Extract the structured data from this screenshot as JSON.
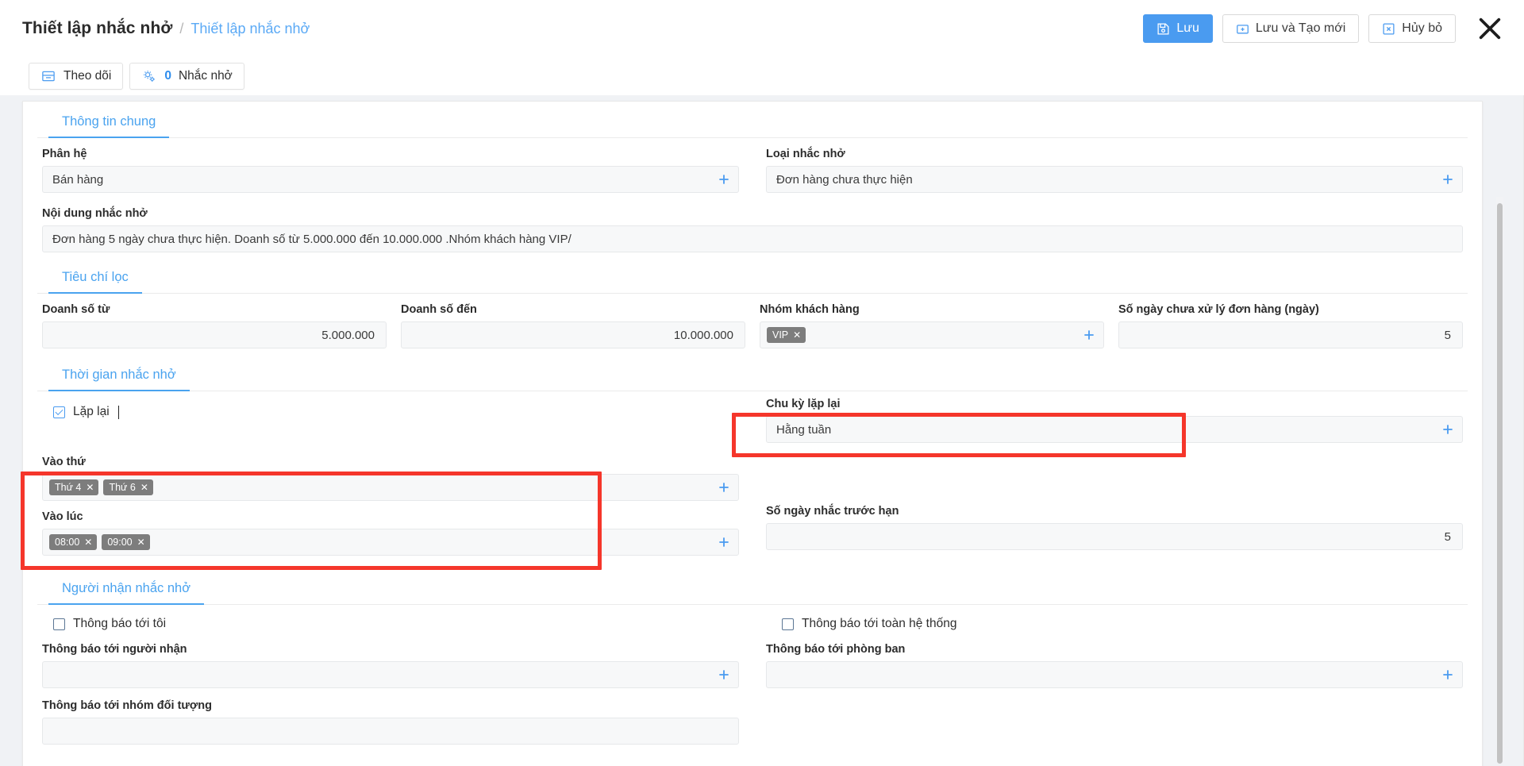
{
  "header": {
    "title": "Thiết lập nhắc nhở",
    "separator": "/",
    "breadcrumb_link": "Thiết lập nhắc nhở",
    "buttons": {
      "save": "Lưu",
      "save_new": "Lưu và Tạo mới",
      "cancel": "Hủy bỏ"
    },
    "icons": {
      "save": "floppy-disk-icon",
      "save_new": "folder-plus-icon",
      "cancel": "x-box-icon",
      "close": "close-icon"
    }
  },
  "toolbar": {
    "follow": {
      "label": "Theo dõi",
      "icon": "inbox-icon"
    },
    "reminder": {
      "count": "0",
      "label": "Nhắc nhở",
      "icon": "gears-icon"
    }
  },
  "sections": {
    "general": {
      "tab": "Thông tin chung",
      "fields": {
        "subsystem": {
          "label": "Phân hệ",
          "value": "Bán hàng"
        },
        "reminder_type": {
          "label": "Loại nhắc nhở",
          "value": "Đơn hàng chưa thực hiện"
        },
        "content": {
          "label": "Nội dung nhắc nhở",
          "value": "Đơn hàng 5 ngày chưa thực hiện. Doanh số từ 5.000.000 đến 10.000.000 .Nhóm khách hàng VIP/"
        }
      }
    },
    "filter": {
      "tab": "Tiêu chí lọc",
      "fields": {
        "revenue_from": {
          "label": "Doanh số từ",
          "value": "5.000.000"
        },
        "revenue_to": {
          "label": "Doanh số đến",
          "value": "10.000.000"
        },
        "customer_group": {
          "label": "Nhóm khách hàng",
          "tags": [
            "VIP"
          ]
        },
        "unprocessed_days": {
          "label": "Số ngày chưa xử lý đơn hàng (ngày)",
          "value": "5"
        }
      }
    },
    "schedule": {
      "tab": "Thời gian nhắc nhở",
      "repeat_checkbox": {
        "label": "Lặp lại",
        "checked": true
      },
      "fields": {
        "cycle": {
          "label": "Chu kỳ lặp lại",
          "value": "Hằng tuần"
        },
        "on_days": {
          "label": "Vào thứ",
          "tags": [
            "Thứ 4",
            "Thứ 6"
          ]
        },
        "at_times": {
          "label": "Vào lúc",
          "tags": [
            "08:00",
            "09:00"
          ]
        },
        "days_before": {
          "label": "Số ngày nhắc trước hạn",
          "value": "5"
        }
      }
    },
    "recipients": {
      "tab": "Người nhận nhắc nhở",
      "notify_me": {
        "label": "Thông báo tới tôi",
        "checked": false
      },
      "notify_all": {
        "label": "Thông báo tới toàn hệ thống",
        "checked": false
      },
      "fields": {
        "to_person": {
          "label": "Thông báo tới người nhận",
          "value": ""
        },
        "to_department": {
          "label": "Thông báo tới phòng ban",
          "value": ""
        },
        "to_group": {
          "label": "Thông báo tới nhóm đối tượng",
          "value": ""
        }
      }
    }
  },
  "annotations": {
    "highlight_color": "#f5362b",
    "boxes": [
      "chu-ky-lap-lai",
      "vao-thu-vao-luc"
    ]
  },
  "theme": {
    "accent": "#4a9bf0",
    "tab_active": "#4aa3ef",
    "tag_bg": "#7d7d7d",
    "field_bg": "#f7f8f9",
    "page_bg": "#f0f2f5"
  }
}
